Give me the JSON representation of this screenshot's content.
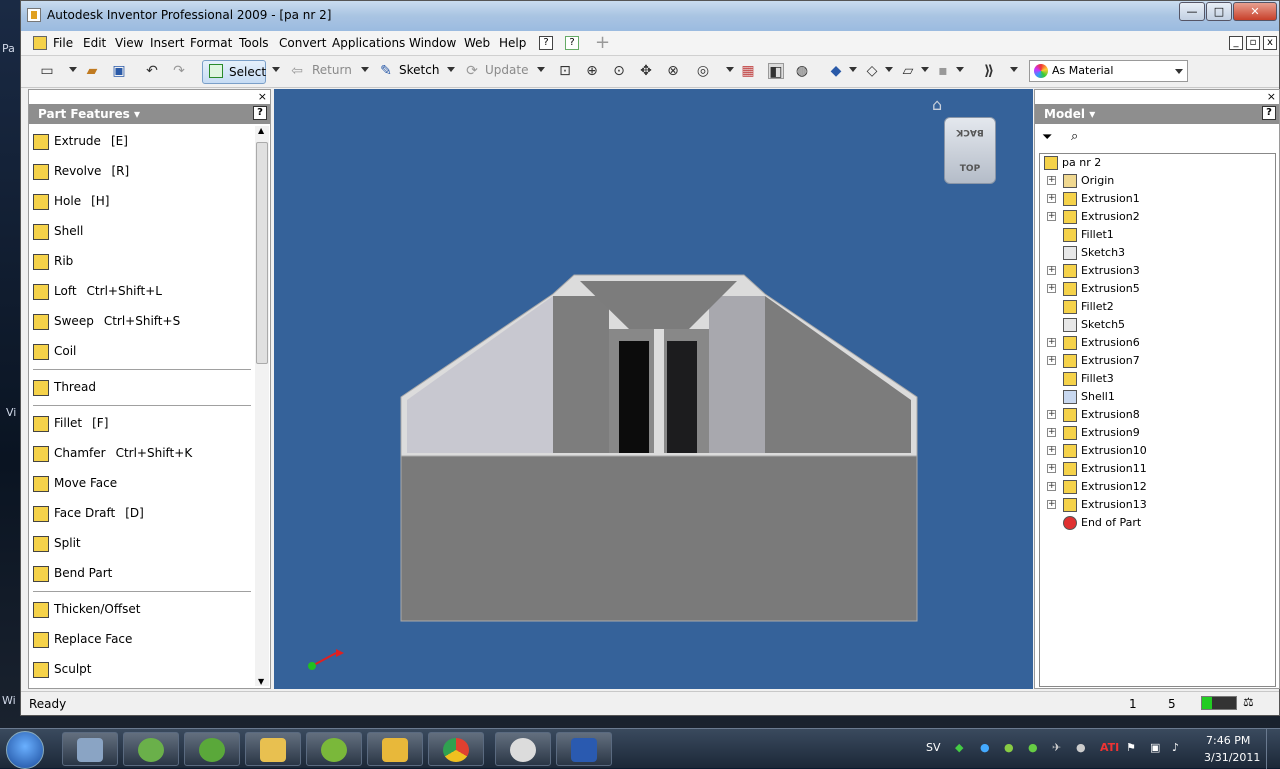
{
  "window": {
    "title": "Autodesk Inventor Professional 2009 - [pa nr 2]",
    "minimize": "—",
    "maximize": "□",
    "close": "✕"
  },
  "menu": [
    "File",
    "Edit",
    "View",
    "Insert",
    "Format",
    "Tools",
    "Convert",
    "Applications",
    "Window",
    "Web",
    "Help"
  ],
  "toolbar": {
    "select": "Select",
    "return": "Return",
    "sketch": "Sketch",
    "update": "Update",
    "material": "As Material"
  },
  "left_panel": {
    "title": "Part Features",
    "features": [
      {
        "label": "Extrude",
        "shortcut": "[E]",
        "icon": "extrude-icon"
      },
      {
        "label": "Revolve",
        "shortcut": "[R]",
        "icon": "revolve-icon"
      },
      {
        "label": "Hole",
        "shortcut": "[H]",
        "icon": "hole-icon"
      },
      {
        "label": "Shell",
        "shortcut": "",
        "icon": "shell-icon"
      },
      {
        "label": "Rib",
        "shortcut": "",
        "icon": "rib-icon"
      },
      {
        "label": "Loft",
        "shortcut": "Ctrl+Shift+L",
        "icon": "loft-icon"
      },
      {
        "label": "Sweep",
        "shortcut": "Ctrl+Shift+S",
        "icon": "sweep-icon"
      },
      {
        "label": "Coil",
        "shortcut": "",
        "icon": "coil-icon"
      },
      {
        "label": "Thread",
        "shortcut": "",
        "icon": "thread-icon"
      },
      {
        "label": "Fillet",
        "shortcut": "[F]",
        "icon": "fillet-icon"
      },
      {
        "label": "Chamfer",
        "shortcut": "Ctrl+Shift+K",
        "icon": "chamfer-icon"
      },
      {
        "label": "Move Face",
        "shortcut": "",
        "icon": "move-face-icon"
      },
      {
        "label": "Face Draft",
        "shortcut": "[D]",
        "icon": "face-draft-icon"
      },
      {
        "label": "Split",
        "shortcut": "",
        "icon": "split-icon"
      },
      {
        "label": "Bend Part",
        "shortcut": "",
        "icon": "bend-part-icon"
      },
      {
        "label": "Thicken/Offset",
        "shortcut": "",
        "icon": "thicken-icon"
      },
      {
        "label": "Replace Face",
        "shortcut": "",
        "icon": "replace-face-icon"
      },
      {
        "label": "Sculpt",
        "shortcut": "",
        "icon": "sculpt-icon"
      }
    ]
  },
  "viewcube": {
    "back": "BACK",
    "top": "TOP"
  },
  "model_panel": {
    "title": "Model",
    "root": "pa nr 2",
    "items": [
      {
        "label": "Origin",
        "expandable": true,
        "icon": "folder-icon"
      },
      {
        "label": "Extrusion1",
        "expandable": true,
        "icon": "extrusion-icon"
      },
      {
        "label": "Extrusion2",
        "expandable": true,
        "icon": "extrusion-icon"
      },
      {
        "label": "Fillet1",
        "expandable": false,
        "icon": "fillet-icon"
      },
      {
        "label": "Sketch3",
        "expandable": false,
        "icon": "sketch-icon"
      },
      {
        "label": "Extrusion3",
        "expandable": true,
        "icon": "extrusion-icon"
      },
      {
        "label": "Extrusion5",
        "expandable": true,
        "icon": "extrusion-icon"
      },
      {
        "label": "Fillet2",
        "expandable": false,
        "icon": "fillet-icon"
      },
      {
        "label": "Sketch5",
        "expandable": false,
        "icon": "sketch-icon"
      },
      {
        "label": "Extrusion6",
        "expandable": true,
        "icon": "extrusion-icon"
      },
      {
        "label": "Extrusion7",
        "expandable": true,
        "icon": "extrusion-icon"
      },
      {
        "label": "Fillet3",
        "expandable": false,
        "icon": "fillet-icon"
      },
      {
        "label": "Shell1",
        "expandable": false,
        "icon": "shell-icon"
      },
      {
        "label": "Extrusion8",
        "expandable": true,
        "icon": "extrusion-icon"
      },
      {
        "label": "Extrusion9",
        "expandable": true,
        "icon": "extrusion-icon"
      },
      {
        "label": "Extrusion10",
        "expandable": true,
        "icon": "extrusion-icon"
      },
      {
        "label": "Extrusion11",
        "expandable": true,
        "icon": "extrusion-icon"
      },
      {
        "label": "Extrusion12",
        "expandable": true,
        "icon": "extrusion-icon"
      },
      {
        "label": "Extrusion13",
        "expandable": true,
        "icon": "extrusion-icon"
      },
      {
        "label": "End of Part",
        "expandable": false,
        "icon": "end-of-part-icon"
      }
    ]
  },
  "status": {
    "text": "Ready",
    "count1": "1",
    "count2": "5"
  },
  "taskbar": {
    "lang": "SV",
    "time": "7:46 PM",
    "date": "3/31/2011"
  },
  "desktop_edge": {
    "a": "Pa",
    "b": "Vi",
    "c": "Wi"
  },
  "colors": {
    "viewport": "#35629a",
    "part_gray": "#7a7a7a",
    "rim": "#dadada"
  }
}
